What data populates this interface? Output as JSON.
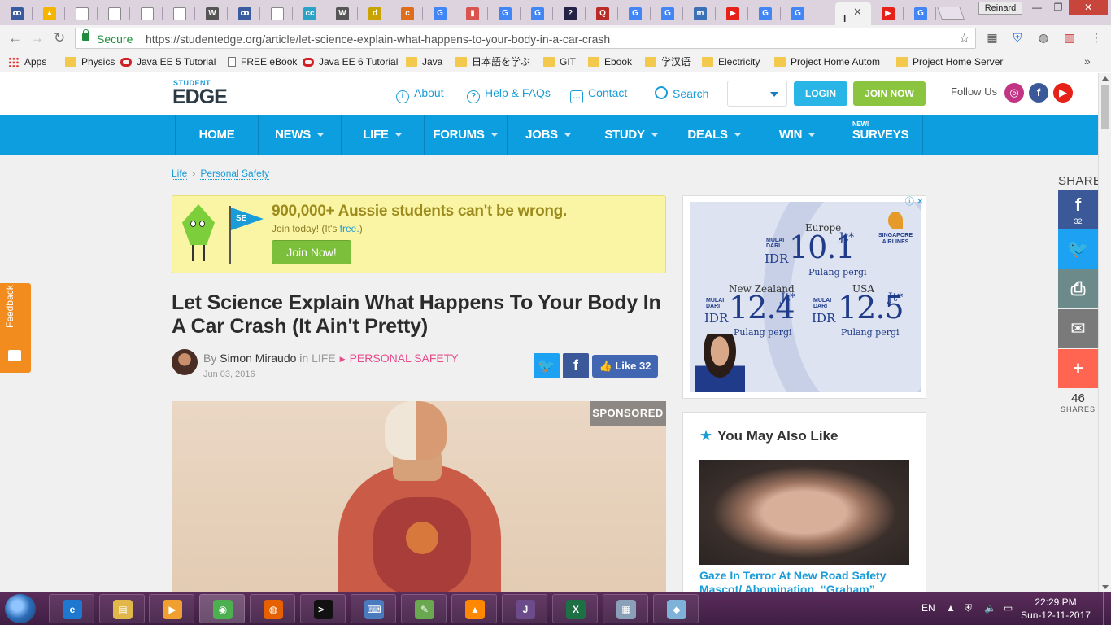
{
  "browser": {
    "tabs": [
      {
        "icon": "google-scholar-icon",
        "glyph": "ꝏ",
        "color": "#3a5ba0"
      },
      {
        "icon": "google-drive-icon",
        "glyph": "▲",
        "color": "#f4b400"
      },
      {
        "icon": "document-icon",
        "glyph": "",
        "color": "#ffffff"
      },
      {
        "icon": "document-icon",
        "glyph": "",
        "color": "#ffffff"
      },
      {
        "icon": "document-icon",
        "glyph": "",
        "color": "#ffffff"
      },
      {
        "icon": "document-icon",
        "glyph": "",
        "color": "#ffffff"
      },
      {
        "icon": "wikipedia-icon",
        "glyph": "W",
        "color": "#555555"
      },
      {
        "icon": "google-scholar-icon",
        "glyph": "ꝏ",
        "color": "#3a5ba0"
      },
      {
        "icon": "document-icon",
        "glyph": "",
        "color": "#ffffff"
      },
      {
        "icon": "cc-icon",
        "glyph": "cc",
        "color": "#2aa3c7"
      },
      {
        "icon": "wikipedia-icon",
        "glyph": "W",
        "color": "#555555"
      },
      {
        "icon": "dictionary-icon",
        "glyph": "d",
        "color": "#c9a400"
      },
      {
        "icon": "csg-icon",
        "glyph": "c",
        "color": "#e06d1c"
      },
      {
        "icon": "google-icon",
        "glyph": "G",
        "color": "#4285f4"
      },
      {
        "icon": "pdf-icon",
        "glyph": "▮",
        "color": "#d9534f"
      },
      {
        "icon": "google-icon",
        "glyph": "G",
        "color": "#4285f4"
      },
      {
        "icon": "google-icon",
        "glyph": "G",
        "color": "#4285f4"
      },
      {
        "icon": "question-icon",
        "glyph": "?",
        "color": "#222244"
      },
      {
        "icon": "quora-icon",
        "glyph": "Q",
        "color": "#b92b27"
      },
      {
        "icon": "google-icon",
        "glyph": "G",
        "color": "#4285f4"
      },
      {
        "icon": "google-icon",
        "glyph": "G",
        "color": "#4285f4"
      },
      {
        "icon": "m-icon",
        "glyph": "m",
        "color": "#3b6fb6"
      },
      {
        "icon": "youtube-icon",
        "glyph": "▶",
        "color": "#e62117"
      },
      {
        "icon": "google-icon",
        "glyph": "G",
        "color": "#4285f4"
      },
      {
        "icon": "google-icon",
        "glyph": "G",
        "color": "#4285f4"
      }
    ],
    "active_tab": {
      "title": "l",
      "close": "✕"
    },
    "extra_tabs": [
      {
        "icon": "youtube-icon",
        "glyph": "▶",
        "color": "#e62117"
      },
      {
        "icon": "google-icon",
        "glyph": "G",
        "color": "#4285f4"
      }
    ],
    "user": "Reinard",
    "window_buttons": {
      "minimize": "—",
      "maximize": "❐",
      "close": "✕"
    },
    "security_label": "Secure",
    "url": "https://studentedge.org/article/let-science-explain-what-happens-to-your-body-in-a-car-crash",
    "bookmarks": [
      {
        "label": "Apps",
        "type": "apps"
      },
      {
        "label": "Physics",
        "type": "folder"
      },
      {
        "label": "Java EE 5 Tutorial",
        "type": "oracle"
      },
      {
        "label": "FREE eBook",
        "type": "doc"
      },
      {
        "label": "Java EE 6 Tutorial",
        "type": "oracle"
      },
      {
        "label": "Java",
        "type": "folder"
      },
      {
        "label": "日本語を学ぶ",
        "type": "folder"
      },
      {
        "label": "GIT",
        "type": "folder"
      },
      {
        "label": "Ebook",
        "type": "folder"
      },
      {
        "label": "学汉语",
        "type": "folder"
      },
      {
        "label": "Electricity",
        "type": "folder"
      },
      {
        "label": "Project Home Autom",
        "type": "folder"
      },
      {
        "label": "Project Home Server",
        "type": "folder"
      }
    ],
    "bookmarks_more": "»"
  },
  "site": {
    "logo_top": "STUDENT",
    "logo_main": "EDGE",
    "header_links": [
      {
        "label": "About",
        "icon": "info-icon",
        "glyph": "i"
      },
      {
        "label": "Help & FAQs",
        "icon": "question-circle-icon",
        "glyph": "?"
      },
      {
        "label": "Contact",
        "icon": "chat-icon",
        "glyph": "…"
      },
      {
        "label": "Search",
        "icon": "search-icon",
        "glyph": ""
      }
    ],
    "login": "LOGIN",
    "join": "JOIN NOW",
    "follow_us": "Follow Us",
    "social": [
      {
        "icon": "instagram-icon",
        "glyph": "◎",
        "color": "#c13584"
      },
      {
        "icon": "facebook-icon",
        "glyph": "f",
        "color": "#3b5998"
      },
      {
        "icon": "youtube-icon",
        "glyph": "▶",
        "color": "#e62117"
      }
    ],
    "nav": [
      {
        "label": "HOME",
        "dropdown": false
      },
      {
        "label": "NEWS",
        "dropdown": true
      },
      {
        "label": "LIFE",
        "dropdown": true
      },
      {
        "label": "FORUMS",
        "dropdown": true
      },
      {
        "label": "JOBS",
        "dropdown": true
      },
      {
        "label": "STUDY",
        "dropdown": true
      },
      {
        "label": "DEALS",
        "dropdown": true
      },
      {
        "label": "WIN",
        "dropdown": true
      },
      {
        "label": "SURVEYS",
        "dropdown": false,
        "tag": "NEW!"
      }
    ],
    "colors": {
      "nav": "#0d9ee0",
      "accent": "#1a9cd8",
      "pink": "#e64b8b",
      "join": "#8bc53f",
      "login": "#29b6e7"
    }
  },
  "article": {
    "breadcrumb": [
      "Life",
      "Personal Safety"
    ],
    "promo": {
      "flag": "SE",
      "title": "900,000+ Aussie students can't be wrong.",
      "sub_prefix": "Join today! (It's ",
      "sub_free": "free.",
      "sub_suffix": ")",
      "button": "Join Now!"
    },
    "title": "Let Science Explain What Happens To Your Body In A Car Crash (It Ain't Pretty)",
    "by": "By",
    "author": "Simon Miraudo",
    "in": "in",
    "category": "LIFE",
    "subcategory": "PERSONAL SAFETY",
    "date": "Jun 03, 2016",
    "share_twitter": "🐦",
    "share_facebook": "f",
    "like_label": "Like",
    "like_count": "32",
    "sponsored": "SPONSORED"
  },
  "ad": {
    "choice": "ⓘ ✕",
    "brand": "SINGAPORE AIRLINES",
    "offers": [
      {
        "city": "Europe",
        "mulai": "MULAI",
        "dari": "DARI",
        "currency": "IDR",
        "price": "10.1",
        "unit": "Jt*",
        "note": "Pulang pergi"
      },
      {
        "city": "New Zealand",
        "mulai": "MULAI",
        "dari": "DARI",
        "currency": "IDR",
        "price": "12.4",
        "unit": "Jt*",
        "note": "Pulang pergi"
      },
      {
        "city": "USA",
        "mulai": "MULAI",
        "dari": "DARI",
        "currency": "IDR",
        "price": "12.5",
        "unit": "Jt*",
        "note": "Pulang pergi"
      }
    ]
  },
  "related": {
    "heading": "You May Also Like",
    "caption": "Gaze In Terror At New Road Safety Mascot/ Abomination, “Graham”"
  },
  "feedback": "Feedback",
  "sharebar": {
    "label": "SHARE",
    "buttons": [
      {
        "icon": "facebook-icon",
        "glyph": "f",
        "count": "32",
        "color": "#3b5998"
      },
      {
        "icon": "twitter-icon",
        "glyph": "🐦",
        "count": "",
        "color": "#1da1f2"
      },
      {
        "icon": "print-icon",
        "glyph": "⎙",
        "count": "",
        "color": "#6d8a8a"
      },
      {
        "icon": "email-icon",
        "glyph": "✉",
        "count": "",
        "color": "#7a7a7a"
      },
      {
        "icon": "plus-icon",
        "glyph": "+",
        "count": "",
        "color": "#ff6550"
      }
    ],
    "total": "46",
    "total_label": "SHARES"
  },
  "taskbar": {
    "apps": [
      {
        "icon": "internet-explorer-icon",
        "glyph": "e",
        "color": "#1e78d0"
      },
      {
        "icon": "file-explorer-icon",
        "glyph": "▤",
        "color": "#e2b74a"
      },
      {
        "icon": "media-player-icon",
        "glyph": "▶",
        "color": "#f0a030"
      },
      {
        "icon": "chrome-icon",
        "glyph": "◉",
        "color": "#4caf50"
      },
      {
        "icon": "firefox-icon",
        "glyph": "◍",
        "color": "#e66000"
      },
      {
        "icon": "cmd-icon",
        "glyph": ">_",
        "color": "#111111"
      },
      {
        "icon": "keyboard-icon",
        "glyph": "⌨",
        "color": "#4a7bbf"
      },
      {
        "icon": "notepad-icon",
        "glyph": "✎",
        "color": "#6aa84f"
      },
      {
        "icon": "vlc-icon",
        "glyph": "▲",
        "color": "#ff8800"
      },
      {
        "icon": "java-ee-ide-icon",
        "glyph": "J",
        "color": "#6b4b8a"
      },
      {
        "icon": "excel-icon",
        "glyph": "X",
        "color": "#1d7044"
      },
      {
        "icon": "calculator-icon",
        "glyph": "▦",
        "color": "#8aa0b8"
      },
      {
        "icon": "notes-icon",
        "glyph": "◆",
        "color": "#7fb2d8"
      }
    ],
    "lang": "EN",
    "time": "22:29 PM",
    "date": "Sun-12-11-2017"
  }
}
